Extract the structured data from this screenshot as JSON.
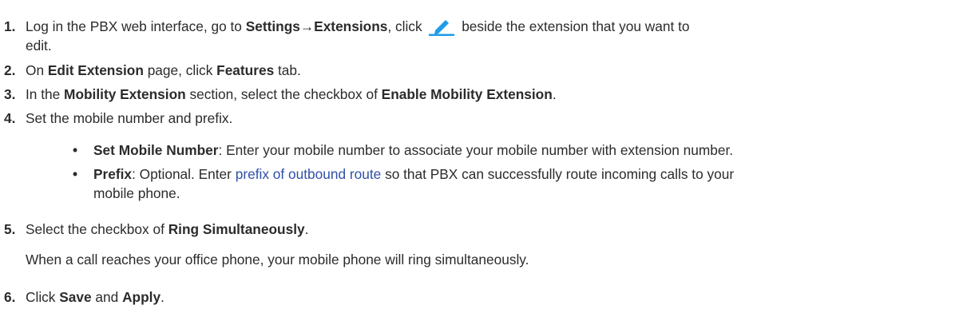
{
  "icons": {
    "edit": "pencil-edit-icon",
    "edit_color": "#1e9be9"
  },
  "steps": [
    {
      "num": "1.",
      "a": "Log in the PBX web interface, go to ",
      "b1": "Settings→Extensions",
      "c": ", click ",
      "d": " beside the extension that you want to",
      "e": "edit."
    },
    {
      "num": "2.",
      "a": "On ",
      "b1": "Edit Extension",
      "c": " page, click ",
      "b2": "Features",
      "d": " tab."
    },
    {
      "num": "3.",
      "a": "In the ",
      "b1": "Mobility Extension",
      "c": " section, select the checkbox of ",
      "b2": "Enable Mobility Extension",
      "d": "."
    },
    {
      "num": "4.",
      "a": "Set the mobile number and prefix."
    },
    {
      "num": "5.",
      "a": "Select the checkbox of ",
      "b1": "Ring Simultaneously",
      "d": ".",
      "note": "When a call reaches your office phone, your mobile phone will ring simultaneously."
    },
    {
      "num": "6.",
      "a": "Click ",
      "b1": "Save",
      "c": " and ",
      "b2": "Apply",
      "d": "."
    }
  ],
  "bullets": [
    {
      "mark": "•",
      "term": "Set Mobile Number",
      "text": ": Enter your mobile number to associate your mobile number with extension number."
    },
    {
      "mark": "•",
      "term": "Prefix",
      "text": ": Optional. Enter ",
      "link": "prefix of outbound route",
      "text2": " so that PBX can successfully route incoming calls to your",
      "text3": "mobile phone."
    }
  ]
}
